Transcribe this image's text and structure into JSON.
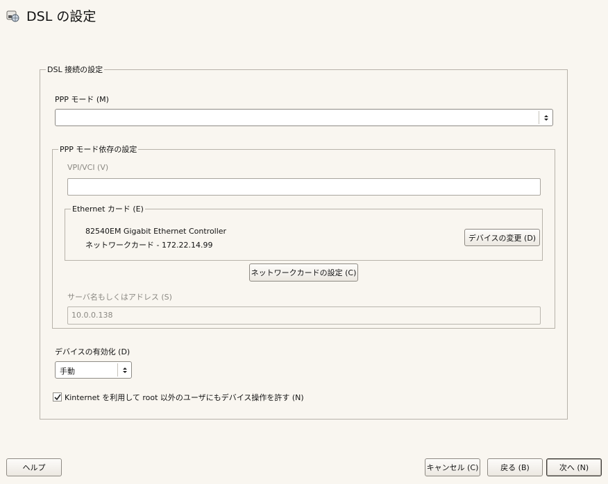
{
  "window": {
    "title": "DSL の設定",
    "title_icon": "network-globe-icon"
  },
  "dsl_group": {
    "legend": "DSL 接続の設定",
    "ppp_mode_label": "PPP モード (M)",
    "ppp_mode_value": "",
    "ppp_dependent": {
      "legend": "PPP モード依存の設定",
      "vpi_vci_label": "VPI/VCI (V)",
      "vpi_vci_value": "",
      "ethernet": {
        "legend": "Ethernet カード (E)",
        "card_name": "82540EM Gigabit Ethernet Controller",
        "card_info": "ネットワークカード - 172.22.14.99",
        "change_device_button": "デバイスの変更 (D)"
      },
      "network_card_settings_button": "ネットワークカードの設定 (C)",
      "server_label": "サーバ名もしくはアドレス (S)",
      "server_value": "10.0.0.138"
    },
    "device_activation_label": "デバイスの有効化 (D)",
    "device_activation_value": "手動",
    "kinternet_checkbox_label": "Kinternet を利用して root 以外のユーザにもデバイス操作を許す (N)",
    "kinternet_checked": true
  },
  "footer": {
    "help_button": "ヘルプ",
    "cancel_button": "キャンセル (C)",
    "back_button": "戻る (B)",
    "next_button": "次へ (N)"
  }
}
